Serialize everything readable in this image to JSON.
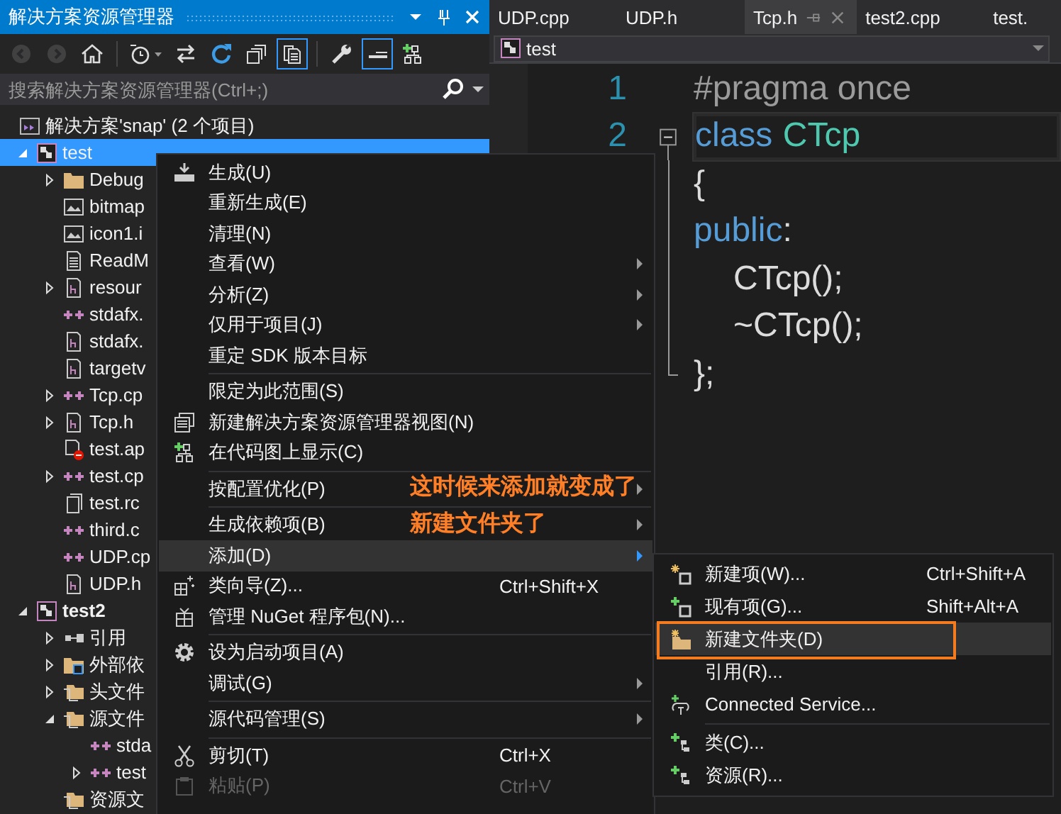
{
  "panel": {
    "title": "解决方案资源管理器",
    "toolbar": [
      {
        "kind": "back",
        "on": false,
        "disabled": true
      },
      {
        "kind": "forward",
        "on": false,
        "disabled": true
      },
      {
        "kind": "home",
        "on": false,
        "disabled": false
      },
      {
        "kind": "history",
        "on": false,
        "disabled": false
      },
      {
        "kind": "sync",
        "on": false,
        "disabled": false
      },
      {
        "kind": "refresh",
        "on": false,
        "disabled": false
      },
      {
        "kind": "collapse",
        "on": false,
        "disabled": false
      },
      {
        "kind": "files",
        "on": true,
        "disabled": false
      },
      {
        "kind": "wrench",
        "on": false,
        "disabled": false
      },
      {
        "kind": "preview",
        "on": true,
        "disabled": false
      },
      {
        "kind": "codemap",
        "on": false,
        "disabled": false
      }
    ],
    "search": {
      "placeholder": "搜索解决方案资源管理器(Ctrl+;)"
    },
    "solution": "解决方案'snap' (2 个项目)",
    "tree": [
      {
        "kind": "project",
        "label": "test",
        "expanded": true,
        "selected": true,
        "startup": false,
        "children": [
          {
            "kind": "folder",
            "label": "Debug",
            "expanded": false,
            "selected": false
          },
          {
            "kind": "image",
            "label": "bitmap",
            "selected": false
          },
          {
            "kind": "image",
            "label": "icon1.i",
            "selected": false
          },
          {
            "kind": "text",
            "label": "ReadM",
            "selected": false
          },
          {
            "kind": "header",
            "label": "resour",
            "expanded": false,
            "selected": false
          },
          {
            "kind": "cpp",
            "label": "stdafx.",
            "selected": false
          },
          {
            "kind": "header",
            "label": "stdafx.",
            "selected": false
          },
          {
            "kind": "header",
            "label": "targetv",
            "selected": false
          },
          {
            "kind": "cpp",
            "label": "Tcp.cp",
            "expanded": false,
            "selected": false
          },
          {
            "kind": "header",
            "label": "Tcp.h",
            "expanded": false,
            "selected": false
          },
          {
            "kind": "excluded",
            "label": "test.ap",
            "selected": false
          },
          {
            "kind": "cpp",
            "label": "test.cp",
            "expanded": false,
            "selected": false
          },
          {
            "kind": "rc",
            "label": "test.rc",
            "selected": false
          },
          {
            "kind": "cpp",
            "label": "third.c",
            "selected": false
          },
          {
            "kind": "cpp",
            "label": "UDP.cp",
            "selected": false
          },
          {
            "kind": "header",
            "label": "UDP.h",
            "selected": false
          }
        ]
      },
      {
        "kind": "project",
        "label": "test2",
        "expanded": true,
        "selected": false,
        "startup": true,
        "children": [
          {
            "kind": "reference",
            "label": "引用",
            "expanded": false,
            "selected": false
          },
          {
            "kind": "external",
            "label": "外部依",
            "expanded": false,
            "selected": false
          },
          {
            "kind": "filter",
            "label": "头文件",
            "expanded": false,
            "selected": false
          },
          {
            "kind": "filter",
            "label": "源文件",
            "expanded": true,
            "selected": false,
            "children": [
              {
                "kind": "cpp",
                "label": "stda",
                "selected": false
              },
              {
                "kind": "cpp",
                "label": "test",
                "expanded": false,
                "selected": false
              }
            ]
          },
          {
            "kind": "filter",
            "label": "资源文",
            "selected": false
          }
        ]
      }
    ]
  },
  "editor": {
    "tabs": [
      {
        "label": "UDP.cpp",
        "selected": false
      },
      {
        "label": "UDP.h",
        "selected": false
      },
      {
        "label": "Tcp.h",
        "selected": true
      },
      {
        "label": "test2.cpp",
        "selected": false
      },
      {
        "label": "test.",
        "selected": false
      }
    ],
    "nav": "test",
    "lines": [
      {
        "number": "1",
        "current": false,
        "tokens": [
          {
            "kind": "preproc",
            "text": "#pragma once"
          }
        ]
      },
      {
        "number": "2",
        "expanded": true,
        "current": true,
        "tokens": [
          {
            "kind": "keyword",
            "text": "class"
          },
          {
            "kind": "type",
            "text": "CTcp"
          }
        ]
      },
      {
        "current": false,
        "tokens": [
          {
            "kind": "plain",
            "text": "{"
          }
        ]
      },
      {
        "current": false,
        "tokens": [
          {
            "kind": "keyword",
            "text": "public"
          },
          {
            "kind": "plain",
            "text": ":"
          }
        ]
      },
      {
        "current": false,
        "tokens": [
          {
            "kind": "plain",
            "text": "CTcp();"
          }
        ]
      },
      {
        "current": false,
        "tokens": [
          {
            "kind": "plain",
            "text": "~CTcp();"
          }
        ]
      },
      {
        "current": false,
        "tokens": [
          {
            "kind": "plain",
            "text": "};"
          }
        ]
      }
    ]
  },
  "context_menu": {
    "items": [
      {
        "kind": "build",
        "label": "生成(U)",
        "submenu": false,
        "selected": false,
        "disabled": false
      },
      {
        "kind": "plain",
        "label": "重新生成(E)",
        "submenu": false,
        "selected": false,
        "disabled": false
      },
      {
        "kind": "plain",
        "label": "清理(N)",
        "submenu": false,
        "selected": false,
        "disabled": false
      },
      {
        "kind": "plain",
        "label": "查看(W)",
        "submenu": true,
        "selected": false,
        "disabled": false
      },
      {
        "kind": "plain",
        "label": "分析(Z)",
        "submenu": true,
        "selected": false,
        "disabled": false
      },
      {
        "kind": "plain",
        "label": "仅用于项目(J)",
        "submenu": true,
        "selected": false,
        "disabled": false
      },
      {
        "kind": "plain",
        "label": "重定 SDK 版本目标",
        "submenu": false,
        "selected": false,
        "disabled": false
      },
      {
        "kind": "separator"
      },
      {
        "kind": "plain",
        "label": "限定为此范围(S)",
        "submenu": false,
        "selected": false,
        "disabled": false
      },
      {
        "kind": "newview",
        "label": "新建解决方案资源管理器视图(N)",
        "submenu": false,
        "selected": false,
        "disabled": false
      },
      {
        "kind": "codemap",
        "label": "在代码图上显示(C)",
        "submenu": false,
        "selected": false,
        "disabled": false
      },
      {
        "kind": "separator"
      },
      {
        "kind": "plain",
        "label": "按配置优化(P)",
        "note": "这时候来添加就变成了",
        "submenu": true,
        "selected": false,
        "disabled": false
      },
      {
        "kind": "separator"
      },
      {
        "kind": "plain",
        "label": "生成依赖项(B)",
        "note": "新建文件夹了",
        "submenu": true,
        "selected": false,
        "disabled": false
      },
      {
        "kind": "plain",
        "label": "添加(D)",
        "submenu": true,
        "selected": true,
        "disabled": false
      },
      {
        "kind": "wizard",
        "label": "类向导(Z)...",
        "shortcut": "Ctrl+Shift+X",
        "submenu": false,
        "selected": false,
        "disabled": false
      },
      {
        "kind": "package",
        "label": "管理 NuGet 程序包(N)...",
        "submenu": false,
        "selected": false,
        "disabled": false
      },
      {
        "kind": "separator"
      },
      {
        "kind": "gear",
        "label": "设为启动项目(A)",
        "submenu": false,
        "selected": false,
        "disabled": false
      },
      {
        "kind": "plain",
        "label": "调试(G)",
        "submenu": true,
        "selected": false,
        "disabled": false
      },
      {
        "kind": "separator"
      },
      {
        "kind": "plain",
        "label": "源代码管理(S)",
        "submenu": true,
        "selected": false,
        "disabled": false
      },
      {
        "kind": "separator"
      },
      {
        "kind": "scissors",
        "label": "剪切(T)",
        "shortcut": "Ctrl+X",
        "submenu": false,
        "selected": false,
        "disabled": false
      },
      {
        "kind": "clipboard",
        "label": "粘贴(P)",
        "shortcut": "Ctrl+V",
        "submenu": false,
        "selected": false,
        "disabled": true
      }
    ]
  },
  "submenu": {
    "items": [
      {
        "kind": "newitem",
        "label": "新建项(W)...",
        "shortcut": "Ctrl+Shift+A",
        "selected": false,
        "outlined": false
      },
      {
        "kind": "existing",
        "label": "现有项(G)...",
        "shortcut": "Shift+Alt+A",
        "selected": false,
        "outlined": false
      },
      {
        "kind": "newfolder",
        "label": "新建文件夹(D)",
        "selected": true,
        "outlined": true
      },
      {
        "kind": "plain",
        "label": "引用(R)...",
        "selected": false,
        "outlined": false
      },
      {
        "kind": "service",
        "label": "Connected Service...",
        "selected": false,
        "outlined": false
      },
      {
        "kind": "separator"
      },
      {
        "kind": "addclass",
        "label": "类(C)...",
        "selected": false,
        "outlined": false
      },
      {
        "kind": "addclass",
        "label": "资源(R)...",
        "selected": false,
        "outlined": false
      }
    ]
  }
}
